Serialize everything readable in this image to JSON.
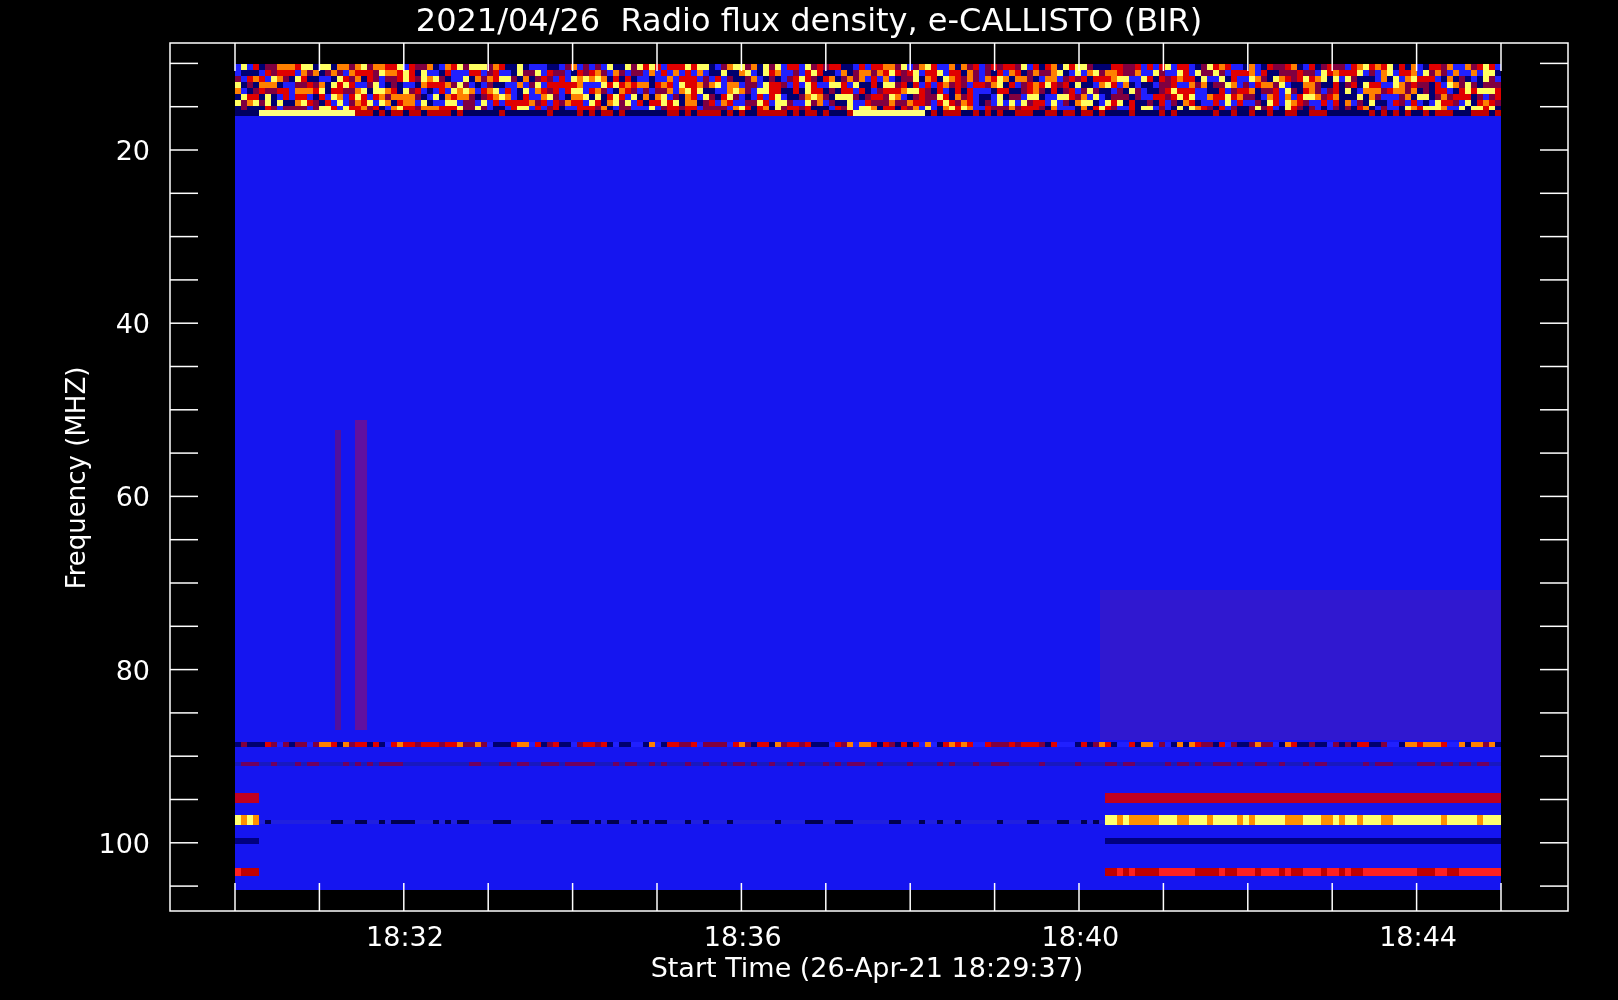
{
  "title": "2021/04/26  Radio flux density, e-CALLISTO (BIR)",
  "y_axis": {
    "label": "Frequency (MHZ)",
    "ticks": [
      "20",
      "40",
      "60",
      "80",
      "100"
    ]
  },
  "x_axis": {
    "label": "Start Time (26-Apr-21 18:29:37)",
    "ticks": [
      "18:32",
      "18:36",
      "18:40",
      "18:44"
    ]
  }
}
